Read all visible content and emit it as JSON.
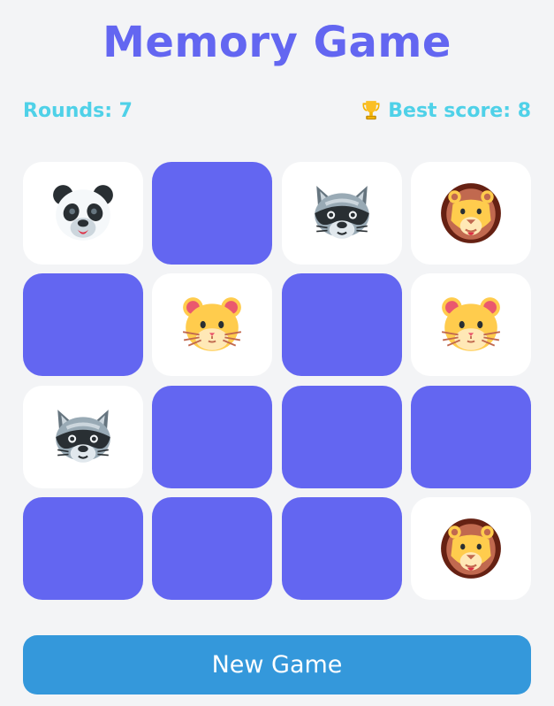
{
  "title": "Memory Game",
  "stats": {
    "rounds": "Rounds: 7",
    "best_score": "Best score: 8",
    "trophy_icon": "trophy-icon"
  },
  "colors": {
    "accent": "#6366f1",
    "stat_text": "#4fd1e8",
    "button": "#3498db",
    "card_face": "#ffffff",
    "background": "#f3f4f6"
  },
  "board": {
    "columns": 4,
    "rows": 4,
    "cards": [
      {
        "state": "revealed",
        "animal": "panda"
      },
      {
        "state": "hidden",
        "animal": null
      },
      {
        "state": "revealed",
        "animal": "raccoon"
      },
      {
        "state": "revealed",
        "animal": "lion"
      },
      {
        "state": "hidden",
        "animal": null
      },
      {
        "state": "revealed",
        "animal": "hamster"
      },
      {
        "state": "hidden",
        "animal": null
      },
      {
        "state": "revealed",
        "animal": "hamster"
      },
      {
        "state": "revealed",
        "animal": "raccoon"
      },
      {
        "state": "hidden",
        "animal": null
      },
      {
        "state": "hidden",
        "animal": null
      },
      {
        "state": "hidden",
        "animal": null
      },
      {
        "state": "hidden",
        "animal": null
      },
      {
        "state": "hidden",
        "animal": null
      },
      {
        "state": "hidden",
        "animal": null
      },
      {
        "state": "revealed",
        "animal": "lion"
      }
    ]
  },
  "new_game_label": "New Game"
}
